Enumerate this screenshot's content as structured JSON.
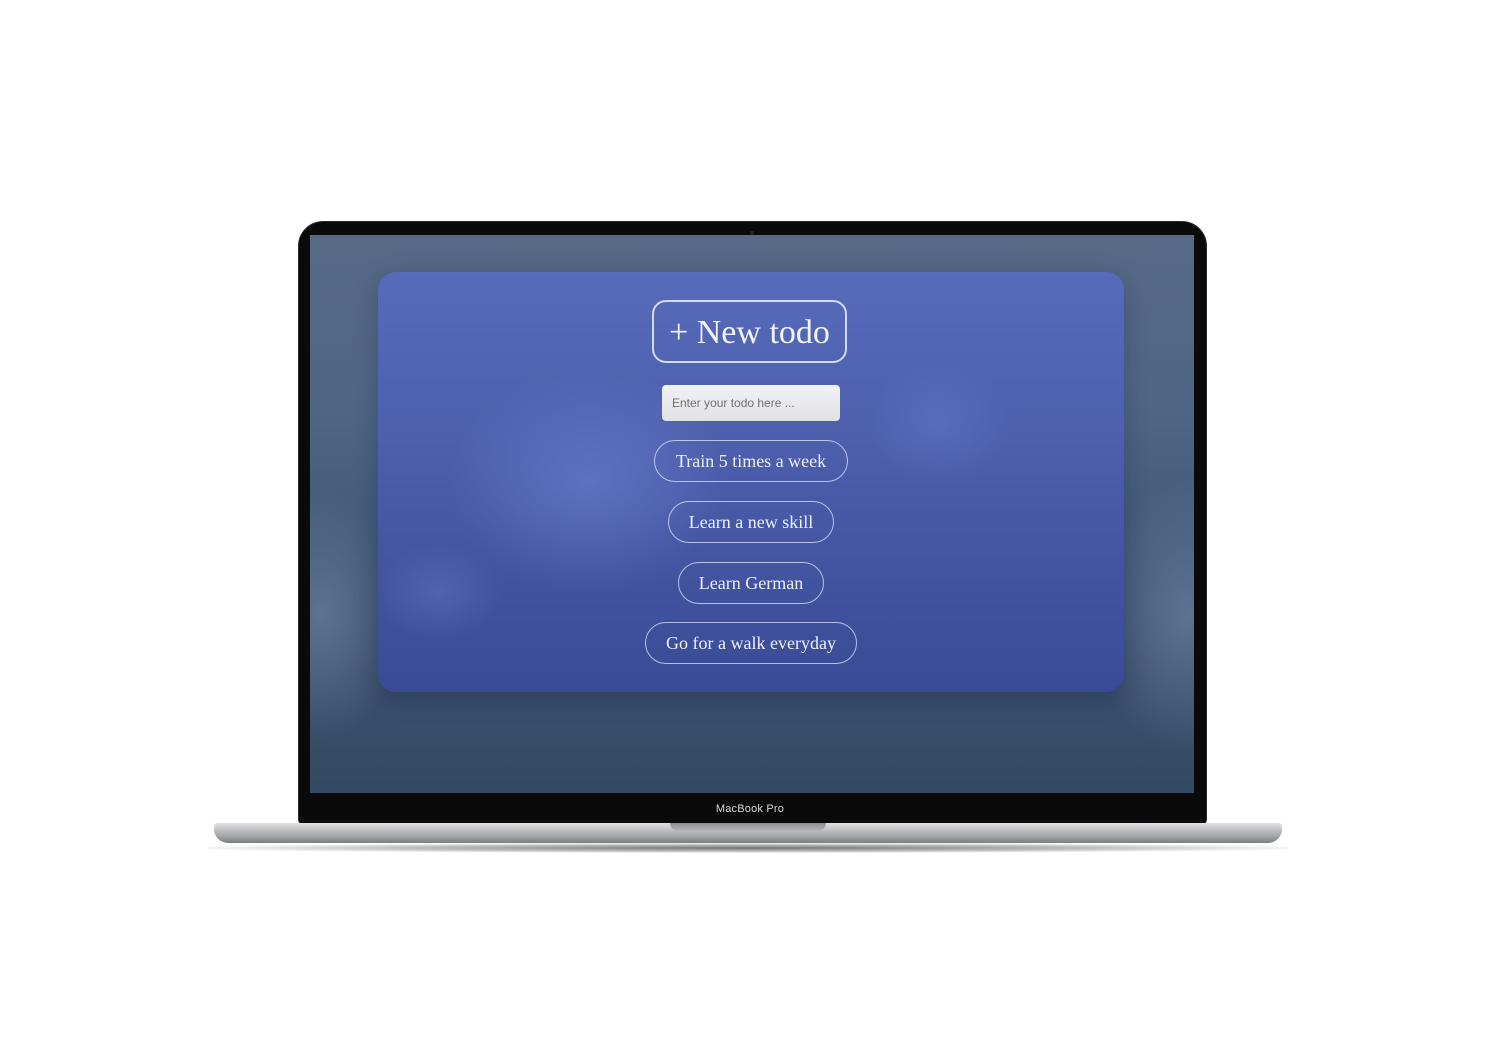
{
  "device": {
    "brand_label": "MacBook Pro"
  },
  "app": {
    "new_todo_label": "+ New todo",
    "input": {
      "value": "",
      "placeholder": "Enter your todo here ..."
    },
    "todos": [
      {
        "label": "Train 5 times a week"
      },
      {
        "label": "Learn a new skill"
      },
      {
        "label": "Learn German"
      },
      {
        "label": "Go for a walk everyday"
      }
    ]
  },
  "colors": {
    "screen_background": "#4f6684",
    "card_background": "#4d5fad",
    "button_border": "#ebeeff",
    "text": "#f3f4ff"
  }
}
